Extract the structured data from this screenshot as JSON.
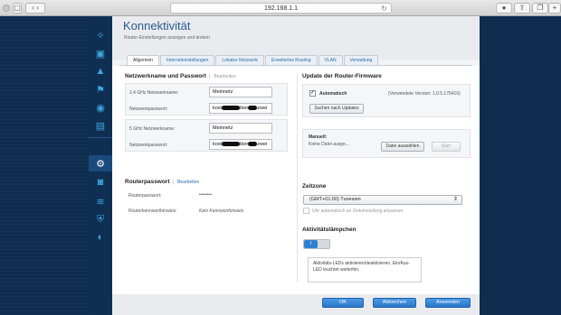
{
  "browser": {
    "url": "192.168.1.1",
    "plus": "+"
  },
  "panel": {
    "title": "Konnektivität",
    "subtitle": "Router-Einstellungen anzeigen und ändern"
  },
  "tabs": [
    {
      "label": "Allgemein",
      "active": true
    },
    {
      "label": "Interneteinstellungen"
    },
    {
      "label": "Lokales Netzwerk"
    },
    {
      "label": "Erweitertes Routing"
    },
    {
      "label": "VLAN"
    },
    {
      "label": "Verwaltung"
    }
  ],
  "network": {
    "title": "Netzwerkname und Passwort",
    "edit": "Bearbeiten",
    "ghz24_label": "2,4 GHz Netzwerkname:",
    "ghz24_name": "Meinnetz",
    "pw_label": "Netzwerkpasswort:",
    "pw_pre": "kost",
    "pw_mid": "bier",
    "pw_post": "zwei",
    "ghz5_label": "5 GHz Netzwerkname:",
    "ghz5_name": "Meinnetz",
    "pw5_label": "Netzwerkpasswort:",
    "pw5_pre": "kost",
    "pw5_mid": "bier",
    "pw5_post": "zwei"
  },
  "router_pw": {
    "title": "Routerpasswort",
    "edit": "Bearbeiten",
    "pw_label": "Routerpasswort:",
    "pw_value": "••••••••",
    "hint_label": "Routerkennworthinweis:",
    "hint_value": "Kein Kennworthinweis"
  },
  "firmware": {
    "title": "Update der Router-Firmware",
    "auto_label": "Automatisch",
    "version": "(Verwendete Version: 1.0.5.176416)",
    "check_button": "Suchen nach Updates",
    "manual_label": "Manuell:",
    "no_file": "Keine Datei ausge...",
    "choose_button": "Datei auswählen",
    "start_button": "Start"
  },
  "timezone": {
    "title": "Zeitzone",
    "selected": "(GMT+01:00) Tunesien",
    "dst_label": "Uhr automatisch an Zeitumstellung anpassen"
  },
  "leds": {
    "title": "Aktivitätslämpchen",
    "toggle_on": "I",
    "note": "Aktivitäts-LEDs aktivieren/deaktivieren. Ein/Aus-LED leuchtet weiterhin."
  },
  "footer": {
    "ok": "OK",
    "cancel": "Abbrechen",
    "apply": "Anwenden"
  },
  "sidebar_icons": [
    "wifi-star-icon",
    "network-map-icon",
    "warning-icon",
    "parental-controls-icon",
    "speed-icon",
    "media-icon",
    "settings-gears-icon",
    "camera-icon",
    "wireless-icon",
    "security-icon",
    "support-icon"
  ]
}
